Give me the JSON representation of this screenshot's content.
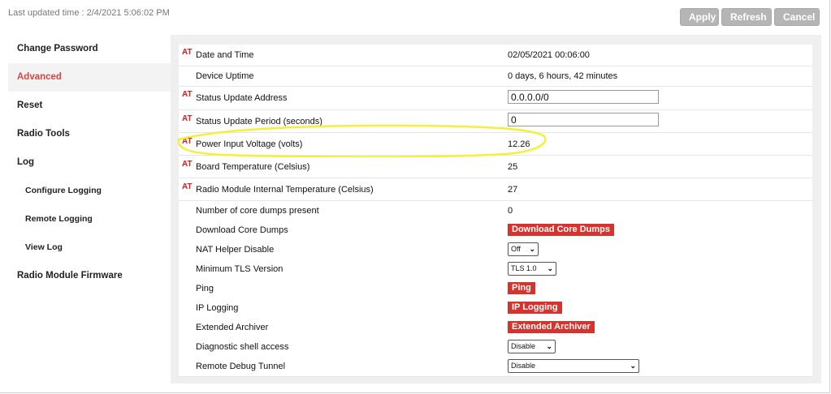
{
  "header": {
    "last_updated": "Last updated time : 2/4/2021 5:06:02 PM",
    "buttons": {
      "apply": "Apply",
      "refresh": "Refresh",
      "cancel": "Cancel"
    }
  },
  "sidebar": {
    "items": [
      {
        "label": "Change Password"
      },
      {
        "label": "Advanced"
      },
      {
        "label": "Reset"
      },
      {
        "label": "Radio Tools"
      },
      {
        "label": "Log"
      },
      {
        "label": "Configure Logging"
      },
      {
        "label": "Remote Logging"
      },
      {
        "label": "View Log"
      },
      {
        "label": "Radio Module Firmware"
      }
    ]
  },
  "at_marker": "AT",
  "rows": [
    {
      "label": "Date and Time",
      "value": "02/05/2021 00:06:00"
    },
    {
      "label": "Device Uptime",
      "value": "0 days, 6 hours, 42 minutes"
    },
    {
      "label": "Status Update Address",
      "value": "0.0.0.0/0"
    },
    {
      "label": "Status Update Period (seconds)",
      "value": "0"
    },
    {
      "label": "Power Input Voltage (volts)",
      "value": "12.26"
    },
    {
      "label": "Board Temperature (Celsius)",
      "value": "25"
    },
    {
      "label": "Radio Module Internal Temperature (Celsius)",
      "value": "27"
    },
    {
      "label": "Number of core dumps present",
      "value": "0"
    },
    {
      "label": "Download Core Dumps",
      "button": "Download Core Dumps"
    },
    {
      "label": "NAT Helper Disable",
      "selected": "Off"
    },
    {
      "label": "Minimum TLS Version",
      "selected": "TLS 1.0"
    },
    {
      "label": "Ping",
      "button": "Ping"
    },
    {
      "label": "IP Logging",
      "button": "IP Logging"
    },
    {
      "label": "Extended Archiver",
      "button": "Extended Archiver"
    },
    {
      "label": "Diagnostic shell access",
      "selected": "Disable"
    },
    {
      "label": "Remote Debug Tunnel",
      "selected": "Disable"
    }
  ],
  "colors": {
    "accent_red": "#d5342e",
    "highlight_yellow": "#f4f03a"
  }
}
